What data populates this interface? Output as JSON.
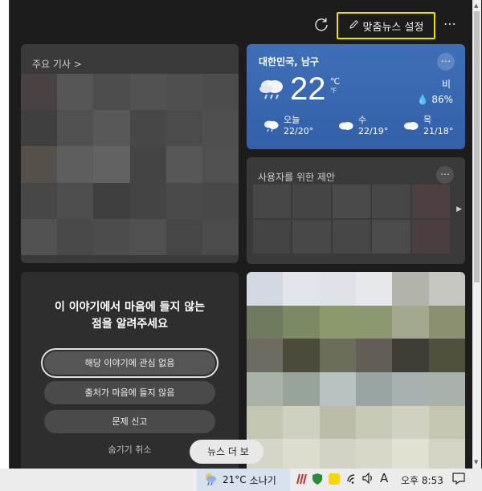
{
  "toolbar": {
    "personalize_label": "맞춤뉴스 설정",
    "more": "⋯",
    "refresh_icon": "refresh-icon",
    "pencil_icon": "pencil-icon"
  },
  "top_stories": {
    "header": "주요 기사 >"
  },
  "weather": {
    "location": "대한민국, 남구",
    "temperature": "22",
    "unit_c": "℃",
    "unit_f": "℉",
    "condition": "비",
    "humidity": "86%",
    "forecast": [
      {
        "day": "오늘",
        "temps": "22/20°"
      },
      {
        "day": "수",
        "temps": "22/19°"
      },
      {
        "day": "목",
        "temps": "21/18°"
      }
    ]
  },
  "suggestions": {
    "header": "사용자를 위한 제안"
  },
  "hide_card": {
    "message_line1": "이 이야기에서 마음에 들지 않는",
    "message_line2": "점을 알려주세요",
    "option1": "해당 이야기에 관심 없음",
    "option2": "출처가 마음에 들지 않음",
    "option3": "문제 신고",
    "undo": "숨기기 취소"
  },
  "more_news": "뉴스 더 보",
  "taskbar": {
    "weather_temp": "21°C",
    "weather_cond": "소나기",
    "ime": "A",
    "time": "오후 8:53"
  },
  "colors": {
    "highlight_border": "#f0e000",
    "weather_card": "#3f6fb8",
    "panel_bg": "#1c1c1c"
  }
}
